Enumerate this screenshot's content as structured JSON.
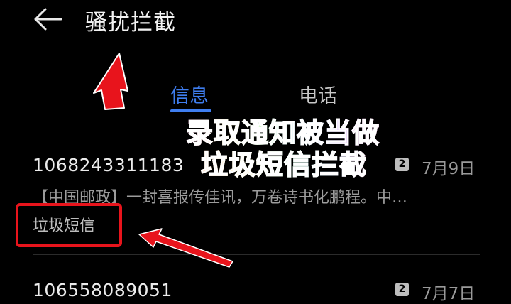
{
  "header": {
    "back_icon": "arrow-left-icon",
    "title": "骚扰拦截"
  },
  "tabs": [
    {
      "label": "信息",
      "active": true
    },
    {
      "label": "电话",
      "active": false
    }
  ],
  "overlay_caption": {
    "line1": "录取通知被当做",
    "line2": "垃圾短信拦截"
  },
  "messages": [
    {
      "sender": "1068243311183",
      "sim_badge": "2",
      "date": "7月9日",
      "preview": "【中国邮政】一封喜报传佳讯，万卷诗书化鹏程。中…",
      "tag": "垃圾短信"
    },
    {
      "sender": "106558089051",
      "sim_badge": "2",
      "date": "7月7日"
    }
  ],
  "colors": {
    "background": "#000000",
    "accent_blue": "#3f7ef0",
    "annotation_red": "#e8141c"
  }
}
